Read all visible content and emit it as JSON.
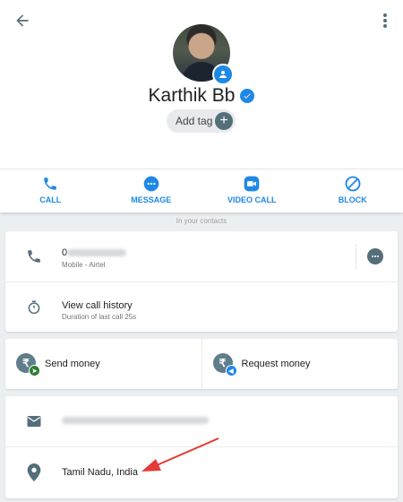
{
  "header": {
    "contact_name": "Karthik Bb",
    "add_tag_label": "Add tag",
    "add_tag_plus": "+"
  },
  "actions": [
    {
      "label": "CALL",
      "icon": "phone-icon"
    },
    {
      "label": "MESSAGE",
      "icon": "chat-bubble-icon"
    },
    {
      "label": "VIDEO CALL",
      "icon": "video-camera-icon"
    },
    {
      "label": "BLOCK",
      "icon": "block-icon"
    }
  ],
  "in_contacts_text": "In your contacts",
  "phone": {
    "number_prefix": "0",
    "subtitle": "Mobile - Airtel"
  },
  "call_history": {
    "title": "View call history",
    "subtitle": "Duration of last call 25s"
  },
  "money": {
    "send_label": "Send money",
    "request_label": "Request money",
    "currency_symbol": "₹"
  },
  "location": {
    "text": "Tamil Nadu, India"
  },
  "colors": {
    "accent": "#1e88e5",
    "icon_gray": "#546e7a",
    "annotation_arrow": "#e53935",
    "background": "#eceff1"
  }
}
